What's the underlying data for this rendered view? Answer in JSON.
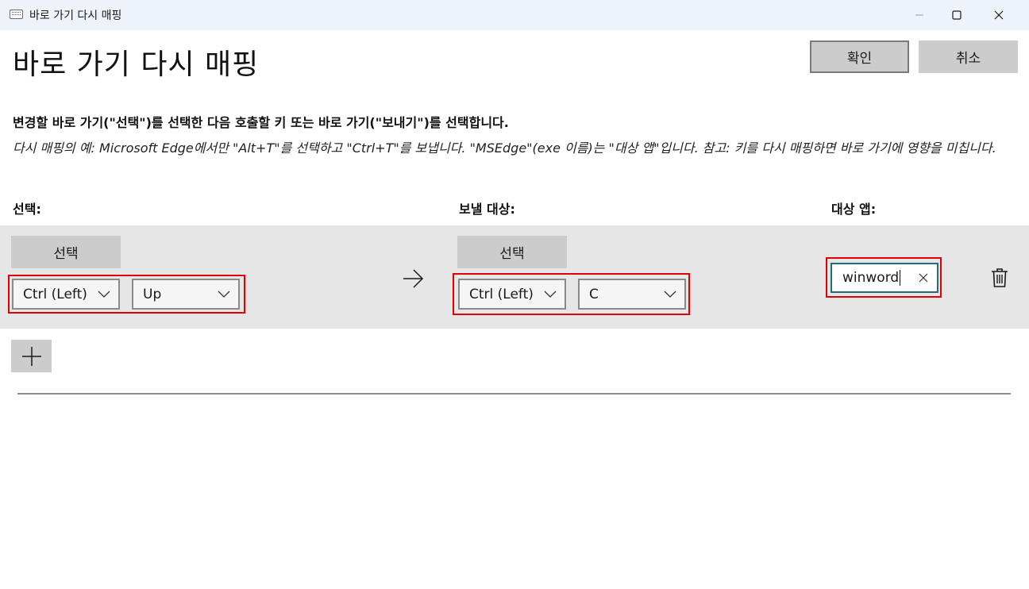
{
  "window": {
    "title": "바로 가기 다시 매핑",
    "icon": "keyboard-icon"
  },
  "page": {
    "title": "바로 가기 다시 매핑",
    "ok_label": "확인",
    "cancel_label": "취소",
    "instruction": "변경할 바로 가기(\"선택\")를 선택한 다음 호출할 키 또는 바로 가기(\"보내기\")를 선택합니다.",
    "example": "다시 매핑의 예: Microsoft Edge에서만 \"Alt+T\"를 선택하고 \"Ctrl+T\"를 보냅니다. \"MSEdge\"(exe 이름)는 \"대상 앱\"입니다. 참고: 키를 다시 매핑하면 바로 가기에 영향을 미칩니다."
  },
  "columns": {
    "select": "선택:",
    "send_to": "보낼 대상:",
    "target_app": "대상 앱:"
  },
  "row": {
    "select_button": "선택",
    "from_keys": [
      "Ctrl (Left)",
      "Up"
    ],
    "to_select_button": "선택",
    "to_keys": [
      "Ctrl (Left)",
      "C"
    ],
    "target_app_value": "winword"
  },
  "colors": {
    "highlight": "#e00000",
    "row_background": "#e6e6e6",
    "button_background": "#cccccc",
    "focus_border": "#1e6f7c"
  }
}
